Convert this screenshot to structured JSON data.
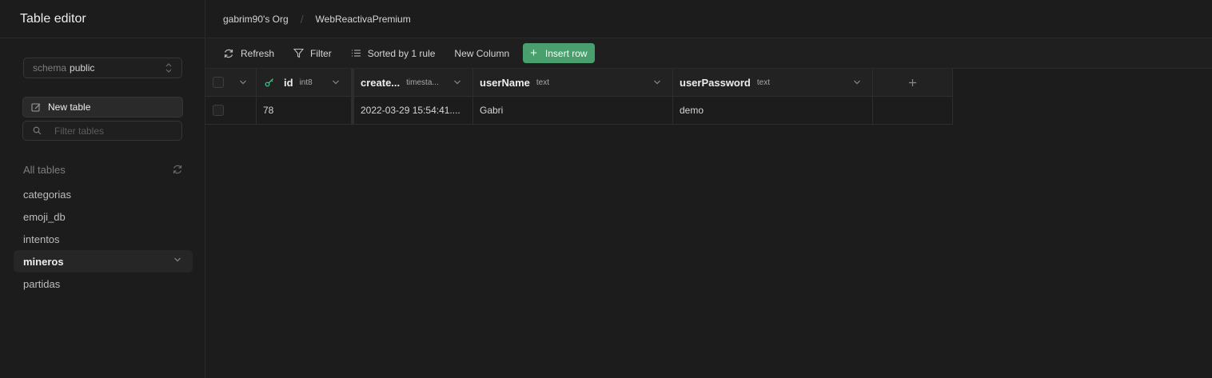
{
  "sidebar": {
    "title": "Table editor",
    "schema": {
      "prefix": "schema",
      "value": "public"
    },
    "new_table_label": "New table",
    "filter_placeholder": "Filter tables",
    "all_tables_label": "All tables",
    "tables": [
      "categorias",
      "emoji_db",
      "intentos",
      "mineros",
      "partidas"
    ],
    "active_table": "mineros"
  },
  "breadcrumb": {
    "org": "gabrim90's Org",
    "project": "WebReactivaPremium",
    "separator": "/"
  },
  "toolbar": {
    "refresh_label": "Refresh",
    "filter_label": "Filter",
    "sort_label": "Sorted by 1 rule",
    "new_column_label": "New Column",
    "insert_row_label": "Insert row"
  },
  "columns": [
    {
      "name": "id",
      "type": "int8"
    },
    {
      "name": "create...",
      "type": "timesta..."
    },
    {
      "name": "userName",
      "type": "text"
    },
    {
      "name": "userPassword",
      "type": "text"
    }
  ],
  "rows": [
    {
      "id": "78",
      "created_at": "2022-03-29 15:54:41....",
      "userName": "Gabri",
      "userPassword": "demo"
    }
  ],
  "colors": {
    "accent": "#4a9f6e",
    "background": "#1c1c1c",
    "key_icon": "#3ecf8e"
  }
}
